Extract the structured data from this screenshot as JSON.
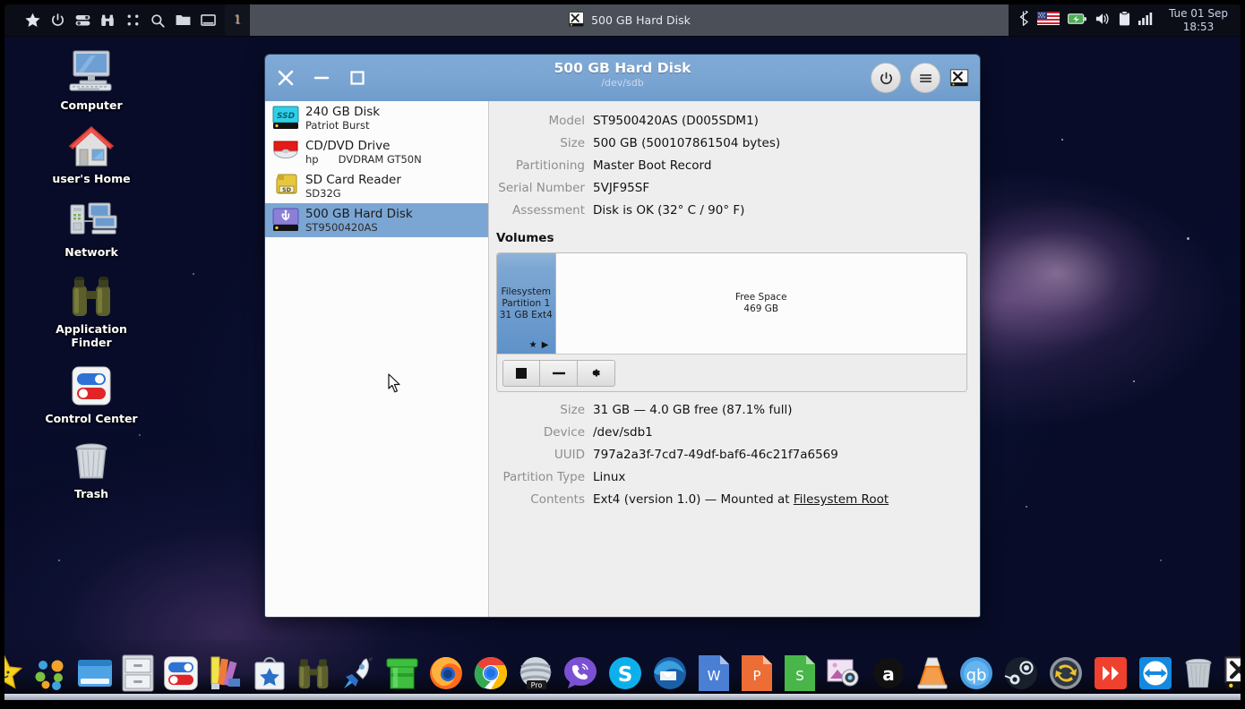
{
  "panel": {
    "launchers": [
      {
        "name": "whisker-menu-icon",
        "glyph": "star"
      },
      {
        "name": "power-icon",
        "glyph": "power"
      },
      {
        "name": "settings-toggle-icon",
        "glyph": "toggles"
      },
      {
        "name": "finder-binoculars-icon",
        "glyph": "binoculars"
      },
      {
        "name": "app-grid-icon",
        "glyph": "grid"
      },
      {
        "name": "search-icon",
        "glyph": "search"
      },
      {
        "name": "file-manager-icon",
        "glyph": "folder"
      },
      {
        "name": "show-desktop-icon",
        "glyph": "window"
      }
    ],
    "workspace": "1",
    "task_button_label": "500 GB Hard Disk",
    "tray": [
      {
        "name": "bluetooth-icon"
      },
      {
        "name": "keyboard-layout-us-flag-icon"
      },
      {
        "name": "battery-icon"
      },
      {
        "name": "volume-icon"
      },
      {
        "name": "clipboard-icon"
      },
      {
        "name": "network-signal-icon"
      }
    ],
    "clock": {
      "date": "Tue 01 Sep",
      "time": "18:53"
    }
  },
  "desktop_icons": [
    {
      "label": "Computer",
      "icon": "computer-icon"
    },
    {
      "label": "user's Home",
      "icon": "home-icon"
    },
    {
      "label": "Network",
      "icon": "network-icon"
    },
    {
      "label": "Application Finder",
      "icon": "binoculars-icon"
    },
    {
      "label": "Control Center",
      "icon": "control-center-icon"
    },
    {
      "label": "Trash",
      "icon": "trash-icon"
    }
  ],
  "window": {
    "title": "500 GB Hard Disk",
    "subtitle": "/dev/sdb",
    "controls": {
      "close": "close-button",
      "minimize": "minimize-button",
      "maximize": "maximize-button",
      "power": "power-button",
      "menu": "hamburger-menu-button",
      "app_icon": "disks-app-icon"
    },
    "accent": "#7ba6d4",
    "titlebar_color": "#7aa5d3"
  },
  "sidebar": {
    "disks": [
      {
        "title": "240 GB Disk",
        "sub": "Patriot Burst",
        "icon": "ssd-icon",
        "selected": false
      },
      {
        "title": "CD/DVD Drive",
        "vendor": "hp",
        "sub": "DVDRAM GT50N",
        "icon": "optical-drive-icon",
        "selected": false
      },
      {
        "title": "SD Card Reader",
        "sub": "SD32G",
        "icon": "sd-card-icon",
        "selected": false
      },
      {
        "title": "500 GB Hard Disk",
        "sub": "ST9500420AS",
        "icon": "usb-drive-icon",
        "selected": true
      }
    ]
  },
  "drive_details": [
    {
      "key": "Model",
      "value": "ST9500420AS (D005SDM1)"
    },
    {
      "key": "Size",
      "value": "500 GB (500107861504 bytes)"
    },
    {
      "key": "Partitioning",
      "value": "Master Boot Record"
    },
    {
      "key": "Serial Number",
      "value": "5VJF95SF"
    },
    {
      "key": "Assessment",
      "value": "Disk is OK (32° C / 90° F)"
    }
  ],
  "volumes": {
    "heading": "Volumes",
    "segments": [
      {
        "name": "filesystem-partition-1",
        "lines": [
          "Filesystem",
          "Partition 1",
          "31 GB Ext4"
        ],
        "percent": 12.5,
        "selected": true,
        "marks": "★ ▶"
      },
      {
        "name": "free-space",
        "lines": [
          "Free Space",
          "469 GB"
        ],
        "percent": 87.5,
        "selected": false,
        "marks": ""
      }
    ],
    "toolbar": [
      {
        "name": "unmount-button",
        "glyph": "stop"
      },
      {
        "name": "delete-partition-button",
        "glyph": "minus"
      },
      {
        "name": "more-actions-button",
        "glyph": "gear"
      }
    ]
  },
  "volume_details": [
    {
      "key": "Size",
      "value": "31 GB — 4.0 GB free (87.1% full)"
    },
    {
      "key": "Device",
      "value": "/dev/sdb1"
    },
    {
      "key": "UUID",
      "value": "797a2a3f-7cd7-49df-baf6-46c21f7a6569"
    },
    {
      "key": "Partition Type",
      "value": "Linux"
    },
    {
      "key": "Contents",
      "value": "Ext4 (version 1.0) — Mounted at ",
      "link": "Filesystem Root"
    }
  ],
  "dock": [
    {
      "name": "dock-whisker-star",
      "glyph": "star-face"
    },
    {
      "name": "dock-app-dots",
      "glyph": "dots"
    },
    {
      "name": "dock-window-manager",
      "glyph": "blue-window"
    },
    {
      "name": "dock-file-cabinet",
      "glyph": "cabinet"
    },
    {
      "name": "dock-control-center",
      "glyph": "toggles"
    },
    {
      "name": "dock-color-picker",
      "glyph": "palette"
    },
    {
      "name": "dock-software-store",
      "glyph": "bag-star"
    },
    {
      "name": "dock-binoculars",
      "glyph": "binoculars"
    },
    {
      "name": "dock-rocket",
      "glyph": "rocket"
    },
    {
      "name": "dock-green-pipe",
      "glyph": "pipe"
    },
    {
      "name": "dock-firefox",
      "glyph": "firefox"
    },
    {
      "name": "dock-chrome",
      "glyph": "chrome"
    },
    {
      "name": "dock-pro-sphere",
      "glyph": "pro"
    },
    {
      "name": "dock-viber",
      "glyph": "viber"
    },
    {
      "name": "dock-skype",
      "glyph": "skype"
    },
    {
      "name": "dock-thunderbird",
      "glyph": "thunderbird"
    },
    {
      "name": "dock-writer",
      "glyph": "writer"
    },
    {
      "name": "dock-impress",
      "glyph": "impress"
    },
    {
      "name": "dock-calc",
      "glyph": "calc"
    },
    {
      "name": "dock-screenshot",
      "glyph": "screenshot"
    },
    {
      "name": "dock-anydesk",
      "glyph": "anydesk"
    },
    {
      "name": "dock-vlc",
      "glyph": "vlc"
    },
    {
      "name": "dock-qbittorrent",
      "glyph": "qb"
    },
    {
      "name": "dock-steam",
      "glyph": "steam"
    },
    {
      "name": "dock-backup",
      "glyph": "backup"
    },
    {
      "name": "dock-red-chevrons",
      "glyph": "chevrons"
    },
    {
      "name": "dock-teamviewer",
      "glyph": "teamviewer"
    },
    {
      "name": "dock-trash",
      "glyph": "trash"
    },
    {
      "name": "dock-disks",
      "glyph": "disks"
    }
  ]
}
